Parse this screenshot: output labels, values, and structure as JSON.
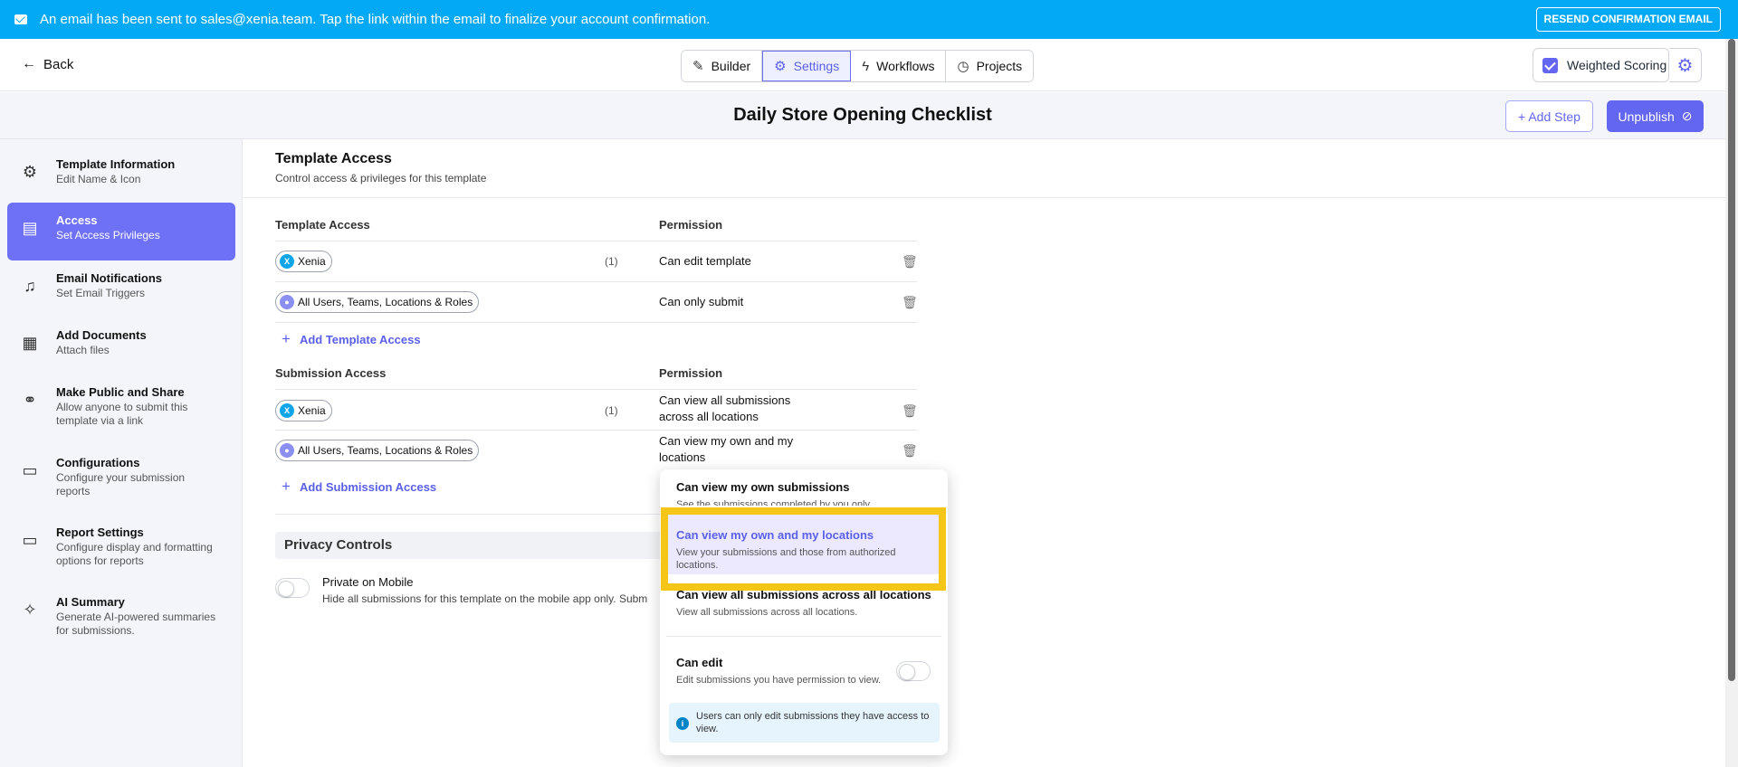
{
  "banner": {
    "message": "An email has been sent to sales@xenia.team. Tap the link within the email to finalize your account confirmation.",
    "resend_label": "RESEND CONFIRMATION EMAIL"
  },
  "header": {
    "back_label": "Back",
    "tabs": [
      {
        "label": "Builder",
        "icon": "edit-icon",
        "active": false
      },
      {
        "label": "Settings",
        "icon": "gear-icon",
        "active": true
      },
      {
        "label": "Workflows",
        "icon": "lightning-icon",
        "active": false
      },
      {
        "label": "Projects",
        "icon": "clock-icon",
        "active": false
      }
    ],
    "weighted_scoring_label": "Weighted Scoring",
    "weighted_scoring_checked": true
  },
  "titlebar": {
    "title": "Daily Store Opening Checklist",
    "add_step_label": "+ Add Step",
    "unpublish_label": "Unpublish"
  },
  "sidebar": {
    "items": [
      {
        "title": "Template Information",
        "subtitle": "Edit Name & Icon",
        "icon": "gear-icon",
        "active": false
      },
      {
        "title": "Access",
        "subtitle": "Set Access Privileges",
        "icon": "access-icon",
        "active": true
      },
      {
        "title": "Email Notifications",
        "subtitle": "Set Email Triggers",
        "icon": "bell-icon",
        "active": false
      },
      {
        "title": "Add Documents",
        "subtitle": "Attach files",
        "icon": "document-icon",
        "active": false
      },
      {
        "title": "Make Public and Share",
        "subtitle": "Allow anyone to submit this template via a link",
        "icon": "link-icon",
        "active": false
      },
      {
        "title": "Configurations",
        "subtitle": "Configure your submission reports",
        "icon": "presentation-icon",
        "active": false
      },
      {
        "title": "Report Settings",
        "subtitle": "Configure display and formatting options for reports",
        "icon": "report-icon",
        "active": false
      },
      {
        "title": "AI Summary",
        "subtitle": "Generate AI-powered summaries for submissions.",
        "icon": "sparkle-icon",
        "active": false
      }
    ]
  },
  "main": {
    "heading": "Template Access",
    "subheading": "Control access & privileges for this template",
    "template_access": {
      "col_access": "Template Access",
      "col_permission": "Permission",
      "rows": [
        {
          "chip": "Xenia",
          "avatar": "X",
          "count": "(1)",
          "permission": "Can edit template"
        },
        {
          "chip": "All Users, Teams, Locations & Roles",
          "avatar": "",
          "count": "",
          "permission": "Can only submit"
        }
      ],
      "add_label": "Add Template Access"
    },
    "submission_access": {
      "col_access": "Submission Access",
      "col_permission": "Permission",
      "rows": [
        {
          "chip": "Xenia",
          "avatar": "X",
          "count": "(1)",
          "permission": "Can view all submissions across all locations"
        },
        {
          "chip": "All Users, Teams, Locations & Roles",
          "avatar": "",
          "count": "",
          "permission": "Can view my own and my locations"
        }
      ],
      "add_label": "Add Submission Access"
    },
    "privacy": {
      "heading": "Privacy Controls",
      "toggle_title": "Private on Mobile",
      "toggle_desc": "Hide all submissions for this template on the mobile app only. Subm",
      "enabled": false
    }
  },
  "dropdown": {
    "options": [
      {
        "title": "Can view my own submissions",
        "desc": "See the submissions completed by you only.",
        "selected": false
      },
      {
        "title": "Can view my own and my locations",
        "desc": "View your submissions and those from authorized locations.",
        "selected": true
      },
      {
        "title": "Can view all submissions across all locations",
        "desc": "View all submissions across all locations.",
        "selected": false
      }
    ],
    "can_edit_title": "Can edit",
    "can_edit_desc": "Edit submissions you have permission to view.",
    "can_edit_enabled": false,
    "info_text": "Users can only edit submissions they have access to view."
  },
  "colors": {
    "banner": "#03a9f4",
    "accent": "#6366f1",
    "highlight_frame": "#f5c518"
  }
}
